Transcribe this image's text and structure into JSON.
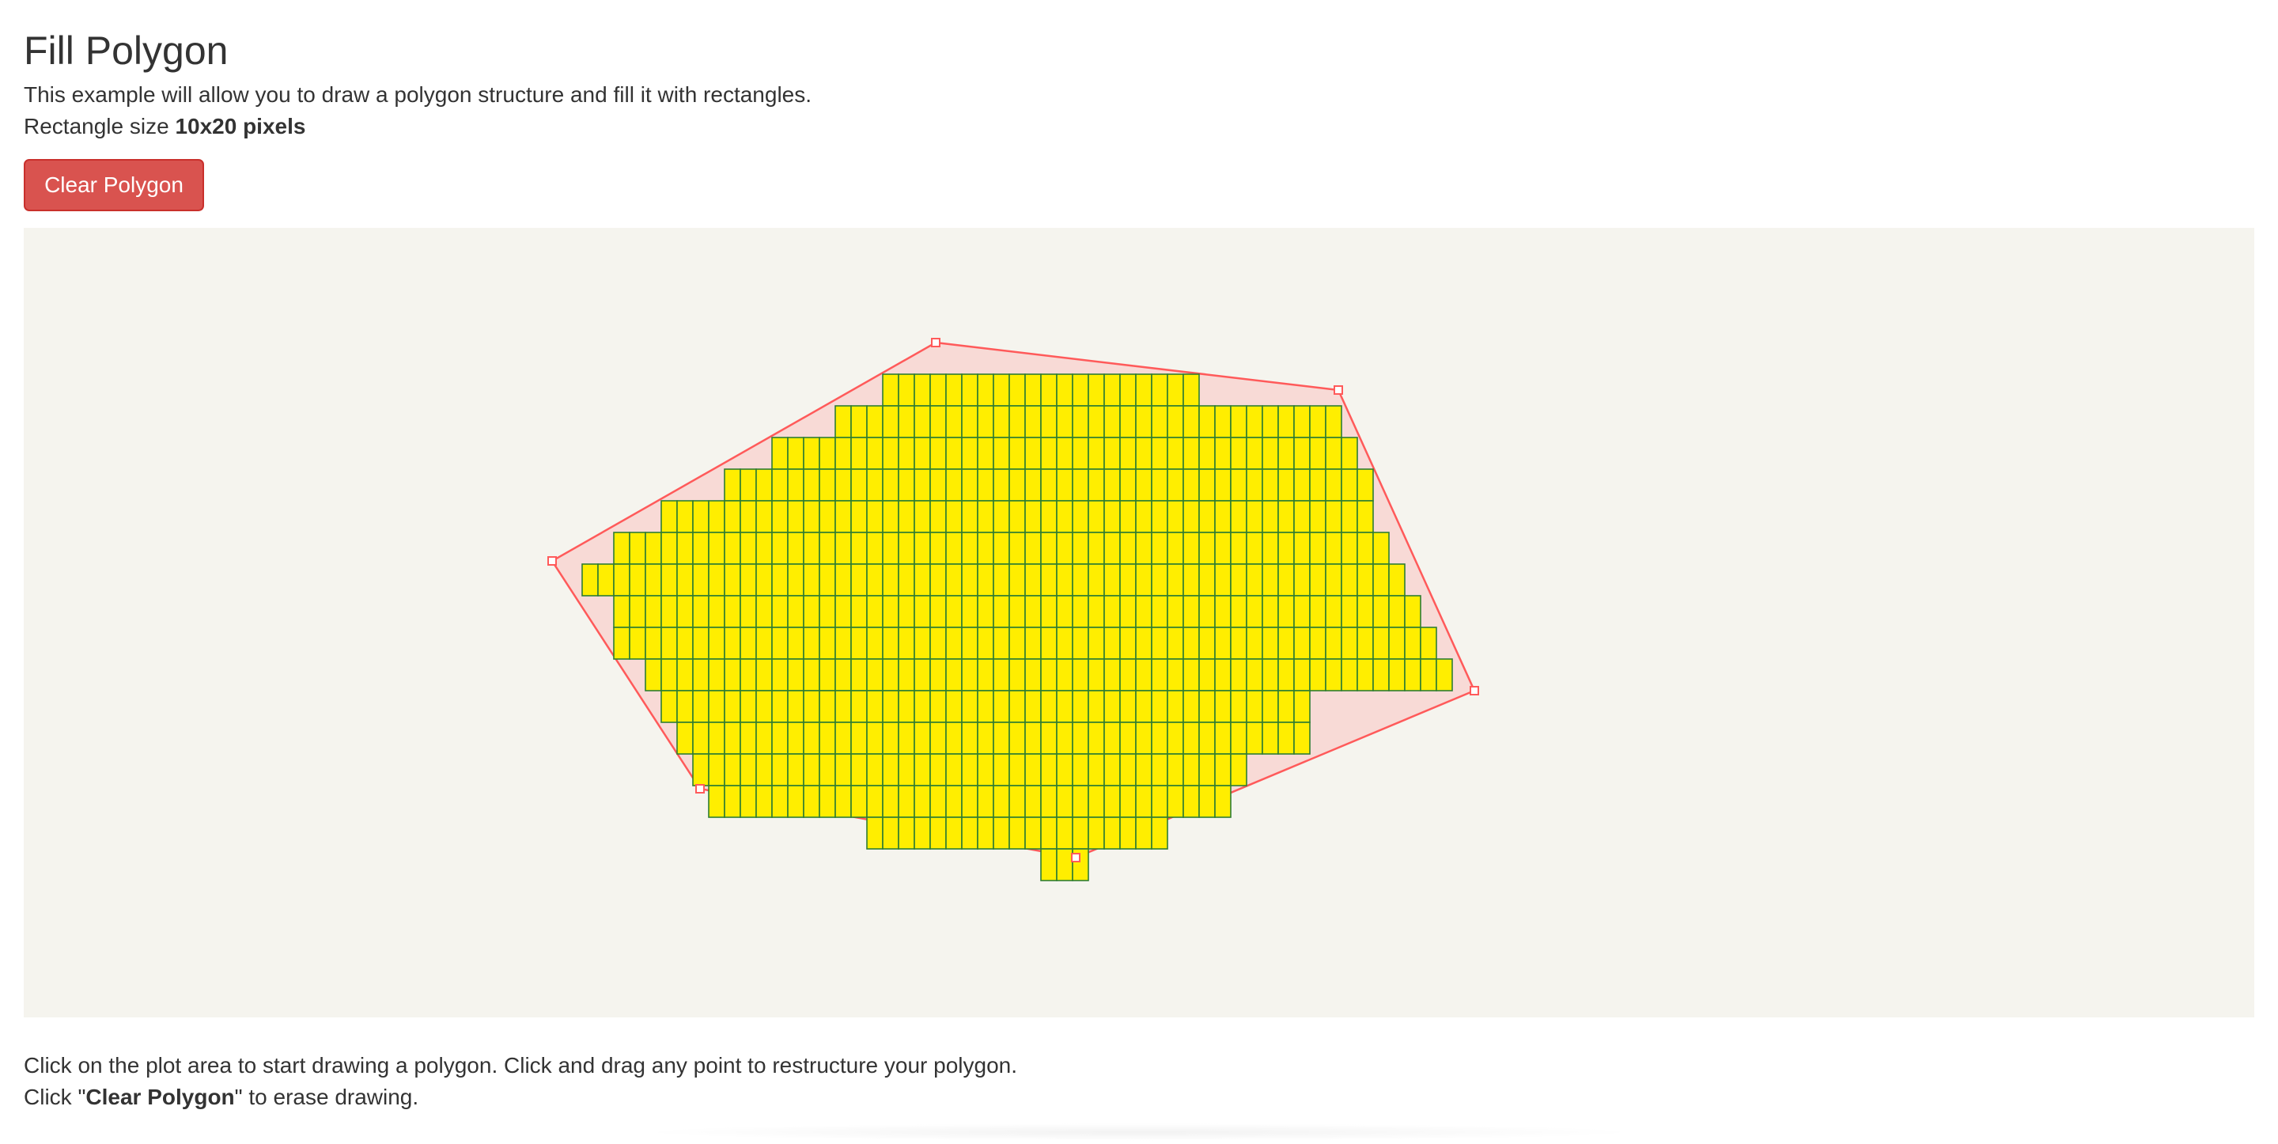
{
  "page": {
    "title": "Fill Polygon",
    "description": "This example will allow you to draw a polygon structure and fill it with rectangles.",
    "rect_size_prefix": "Rectangle size ",
    "rect_size_value": "10x20 pixels"
  },
  "toolbar": {
    "clear_label": "Clear Polygon"
  },
  "plot": {
    "background": "#f5f4ee",
    "polygon_stroke": "#ff5a5a",
    "polygon_fill": "rgba(255,170,170,0.35)",
    "cell_fill": "#ffee00",
    "cell_stroke": "#2e7d32"
  },
  "instructions": {
    "line1": "Click on the plot area to start drawing a polygon. Click and drag any point to restructure your polygon.",
    "line2_prefix": "Click \"",
    "line2_bold": "Clear Polygon",
    "line2_suffix": "\" to erase drawing."
  }
}
